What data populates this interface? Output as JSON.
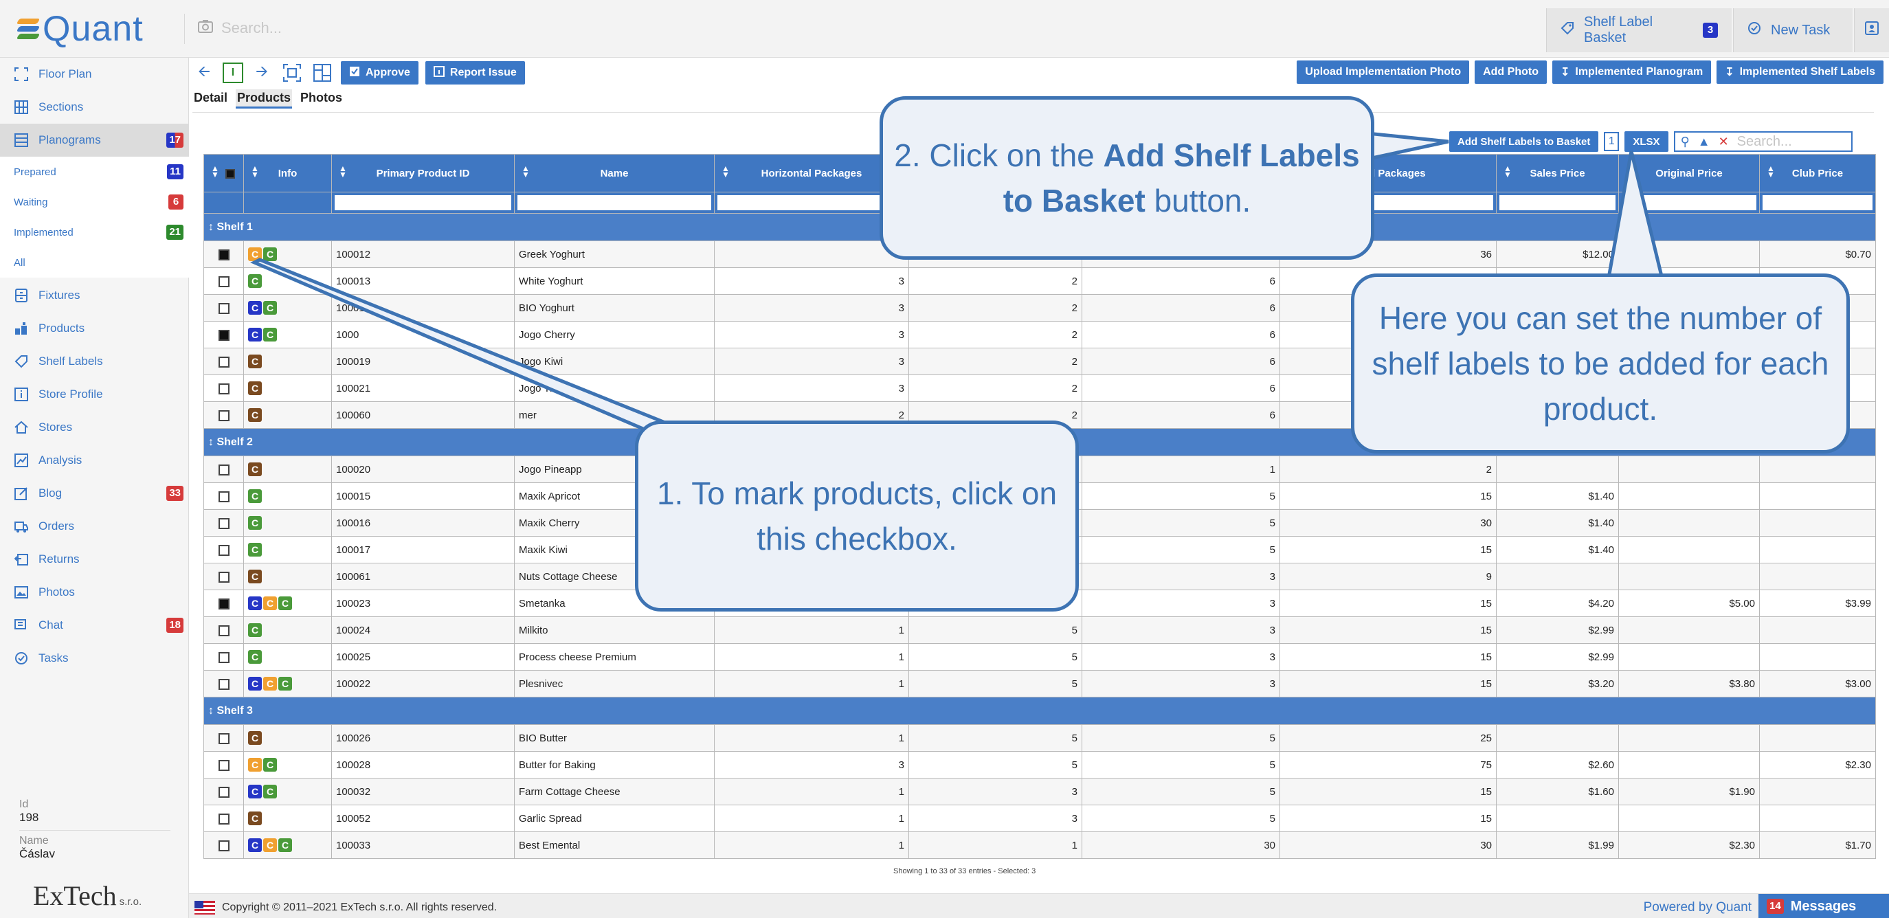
{
  "header": {
    "logo_text": "Quant",
    "search_placeholder": "Search...",
    "shelf_label_basket": "Shelf Label Basket",
    "shelf_label_basket_count": "3",
    "new_task": "New Task"
  },
  "sidebar": {
    "items": [
      {
        "label": "Floor Plan",
        "icon": "floor-plan-icon",
        "badge": ""
      },
      {
        "label": "Sections",
        "icon": "sections-icon",
        "badge": ""
      },
      {
        "label": "Planograms",
        "icon": "planograms-icon",
        "badge": "17"
      },
      {
        "label": "Fixtures",
        "icon": "fixtures-icon",
        "badge": ""
      },
      {
        "label": "Products",
        "icon": "products-icon",
        "badge": ""
      },
      {
        "label": "Shelf Labels",
        "icon": "shelf-labels-icon",
        "badge": ""
      },
      {
        "label": "Store Profile",
        "icon": "store-profile-icon",
        "badge": ""
      },
      {
        "label": "Stores",
        "icon": "stores-icon",
        "badge": ""
      },
      {
        "label": "Analysis",
        "icon": "analysis-icon",
        "badge": ""
      },
      {
        "label": "Blog",
        "icon": "blog-icon",
        "badge": "33"
      },
      {
        "label": "Orders",
        "icon": "orders-icon",
        "badge": ""
      },
      {
        "label": "Returns",
        "icon": "returns-icon",
        "badge": ""
      },
      {
        "label": "Photos",
        "icon": "photos-icon",
        "badge": ""
      },
      {
        "label": "Chat",
        "icon": "chat-icon",
        "badge": "18"
      },
      {
        "label": "Tasks",
        "icon": "tasks-icon",
        "badge": ""
      }
    ],
    "subitems": [
      {
        "label": "Prepared",
        "badge": "11"
      },
      {
        "label": "Waiting",
        "badge": "6"
      },
      {
        "label": "Implemented",
        "badge": "21"
      },
      {
        "label": "All",
        "badge": ""
      }
    ],
    "id_label": "Id",
    "id_value": "198",
    "name_label": "Name",
    "name_value": "Čáslav",
    "company_logo": "ExTech",
    "company_suffix": "s.r.o."
  },
  "toolbar": {
    "mode_letter": "I",
    "approve": "Approve",
    "report_issue": "Report Issue",
    "upload_photo": "Upload Implementation Photo",
    "add_photo": "Add Photo",
    "implemented_planogram": "Implemented Planogram",
    "implemented_shelf_labels": "Implemented Shelf Labels"
  },
  "tabs": [
    "Detail",
    "Products",
    "Photos"
  ],
  "table_tools": {
    "add_labels": "Add Shelf Labels to Basket",
    "quantity": "1",
    "xlsx": "XLSX",
    "search_placeholder": "Search..."
  },
  "table": {
    "columns": [
      "Info",
      "Primary Product ID",
      "Name",
      "Horizontal Packages",
      "",
      "",
      "nned Packages",
      "Sales Price",
      "Original Price",
      "Club Price"
    ],
    "groups": [
      {
        "title": "Shelf 1",
        "rows": [
          {
            "checked": true,
            "tags": [
              "orange",
              "green"
            ],
            "id": "100012",
            "name": "Greek Yoghurt",
            "h": "",
            "c5": "",
            "c6": "",
            "planned": "36",
            "sales": "$12.00",
            "orig": "",
            "club": "$0.70"
          },
          {
            "checked": false,
            "tags": [
              "green"
            ],
            "id": "100013",
            "name": "White Yoghurt",
            "h": "3",
            "c5": "2",
            "c6": "6",
            "planned": "",
            "sales": "",
            "orig": "",
            "club": ""
          },
          {
            "checked": false,
            "tags": [
              "blue",
              "green"
            ],
            "id": "100014",
            "name": "BIO Yoghurt",
            "h": "3",
            "c5": "2",
            "c6": "6",
            "planned": "",
            "sales": "",
            "orig": "",
            "club": ""
          },
          {
            "checked": true,
            "tags": [
              "blue",
              "green"
            ],
            "id": "1000",
            "name": "Jogo Cherry",
            "h": "3",
            "c5": "2",
            "c6": "6",
            "planned": "",
            "sales": "",
            "orig": "",
            "club": ""
          },
          {
            "checked": false,
            "tags": [
              "brown"
            ],
            "id": "100019",
            "name": "Jogo Kiwi",
            "h": "3",
            "c5": "2",
            "c6": "6",
            "planned": "",
            "sales": "",
            "orig": "",
            "club": ""
          },
          {
            "checked": false,
            "tags": [
              "brown"
            ],
            "id": "100021",
            "name": "Jogo Tropic",
            "h": "3",
            "c5": "2",
            "c6": "6",
            "planned": "",
            "sales": "",
            "orig": "",
            "club": ""
          },
          {
            "checked": false,
            "tags": [
              "brown"
            ],
            "id": "100060",
            "name": "mer",
            "h": "2",
            "c5": "2",
            "c6": "6",
            "planned": "",
            "sales": "",
            "orig": "",
            "club": ""
          }
        ]
      },
      {
        "title": "Shelf 2",
        "rows": [
          {
            "checked": false,
            "tags": [
              "brown"
            ],
            "id": "100020",
            "name": "Jogo Pineapp",
            "h": "",
            "c5": "",
            "c6": "1",
            "planned": "2",
            "sales": "",
            "orig": "",
            "club": ""
          },
          {
            "checked": false,
            "tags": [
              "green"
            ],
            "id": "100015",
            "name": "Maxik Apricot",
            "h": "",
            "c5": "",
            "c6": "5",
            "planned": "15",
            "sales": "$1.40",
            "orig": "",
            "club": ""
          },
          {
            "checked": false,
            "tags": [
              "green"
            ],
            "id": "100016",
            "name": "Maxik Cherry",
            "h": "",
            "c5": "",
            "c6": "5",
            "planned": "30",
            "sales": "$1.40",
            "orig": "",
            "club": ""
          },
          {
            "checked": false,
            "tags": [
              "green"
            ],
            "id": "100017",
            "name": "Maxik Kiwi",
            "h": "",
            "c5": "",
            "c6": "5",
            "planned": "15",
            "sales": "$1.40",
            "orig": "",
            "club": ""
          },
          {
            "checked": false,
            "tags": [
              "brown"
            ],
            "id": "100061",
            "name": "Nuts Cottage Cheese",
            "h": "",
            "c5": "",
            "c6": "3",
            "planned": "9",
            "sales": "",
            "orig": "",
            "club": ""
          },
          {
            "checked": true,
            "tags": [
              "blue",
              "orange",
              "green"
            ],
            "id": "100023",
            "name": "Smetanka",
            "h": "",
            "c5": "",
            "c6": "3",
            "planned": "15",
            "sales": "$4.20",
            "orig": "$5.00",
            "club": "$3.99"
          },
          {
            "checked": false,
            "tags": [
              "green"
            ],
            "id": "100024",
            "name": "Milkito",
            "h": "1",
            "c5": "5",
            "c6": "3",
            "planned": "15",
            "sales": "$2.99",
            "orig": "",
            "club": ""
          },
          {
            "checked": false,
            "tags": [
              "green"
            ],
            "id": "100025",
            "name": "Process cheese Premium",
            "h": "1",
            "c5": "5",
            "c6": "3",
            "planned": "15",
            "sales": "$2.99",
            "orig": "",
            "club": ""
          },
          {
            "checked": false,
            "tags": [
              "blue",
              "orange",
              "green"
            ],
            "id": "100022",
            "name": "Plesnivec",
            "h": "1",
            "c5": "5",
            "c6": "3",
            "planned": "15",
            "sales": "$3.20",
            "orig": "$3.80",
            "club": "$3.00"
          }
        ]
      },
      {
        "title": "Shelf 3",
        "rows": [
          {
            "checked": false,
            "tags": [
              "brown"
            ],
            "id": "100026",
            "name": "BIO Butter",
            "h": "1",
            "c5": "5",
            "c6": "5",
            "planned": "25",
            "sales": "",
            "orig": "",
            "club": ""
          },
          {
            "checked": false,
            "tags": [
              "orange",
              "green"
            ],
            "id": "100028",
            "name": "Butter for Baking",
            "h": "3",
            "c5": "5",
            "c6": "5",
            "planned": "75",
            "sales": "$2.60",
            "orig": "",
            "club": "$2.30"
          },
          {
            "checked": false,
            "tags": [
              "blue",
              "green"
            ],
            "id": "100032",
            "name": "Farm Cottage Cheese",
            "h": "1",
            "c5": "3",
            "c6": "5",
            "planned": "15",
            "sales": "$1.60",
            "orig": "$1.90",
            "club": ""
          },
          {
            "checked": false,
            "tags": [
              "brown"
            ],
            "id": "100052",
            "name": "Garlic Spread",
            "h": "1",
            "c5": "3",
            "c6": "5",
            "planned": "15",
            "sales": "",
            "orig": "",
            "club": ""
          },
          {
            "checked": false,
            "tags": [
              "blue",
              "orange",
              "green"
            ],
            "id": "100033",
            "name": "Best Emental",
            "h": "1",
            "c5": "1",
            "c6": "30",
            "planned": "30",
            "sales": "$1.99",
            "orig": "$2.30",
            "club": "$1.70"
          }
        ]
      }
    ],
    "tag_letter": "C",
    "footer": "Showing 1 to 33 of 33 entries - Selected: 3"
  },
  "footer": {
    "copyright": "Copyright © 2011–2021 ExTech s.r.o. All rights reserved.",
    "powered": "Powered by Quant",
    "messages_count": "14",
    "messages": "Messages"
  },
  "callouts": {
    "step1": "1. To mark products, click on this checkbox.",
    "step2_pre": "2. Click on the ",
    "step2_bold": "Add Shelf Labels to Basket",
    "step2_post": " button.",
    "step3": "Here you can set the number of shelf labels to be added for each product."
  },
  "colors": {
    "accent": "#3a77c6",
    "header_blue": "#3f77c2",
    "callout_border": "#3d73b3",
    "callout_bg": "#ecf1f8"
  }
}
